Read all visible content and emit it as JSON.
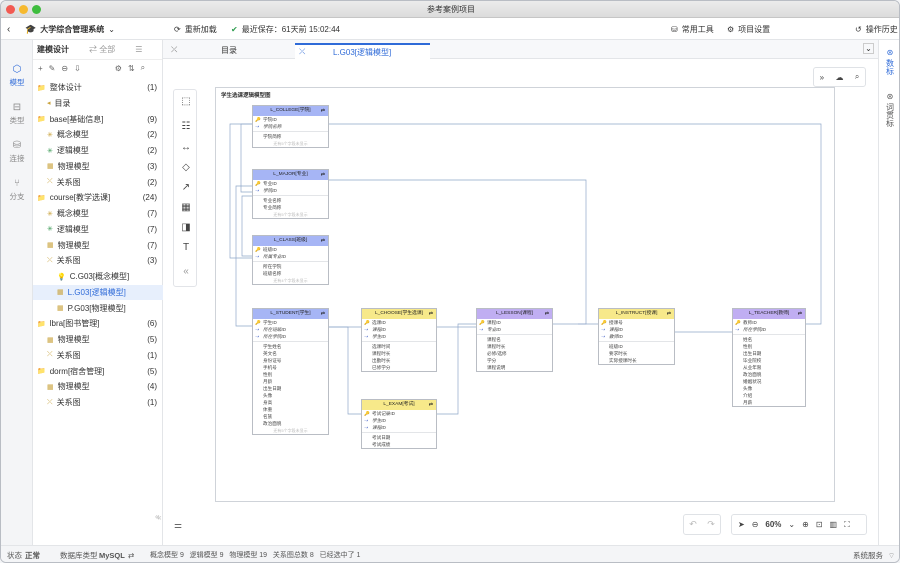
{
  "window": {
    "title": "参考案例项目"
  },
  "topbar": {
    "app_name": "大学综合管理系统",
    "reload": "重新加载",
    "last_save": "最近保存：61天前 15:02:44",
    "common_tools": "常用工具",
    "project_settings": "项目设置",
    "history": "操作历史"
  },
  "rail": {
    "model": "模型",
    "type": "类型",
    "connect": "连接",
    "branch": "分支"
  },
  "sidebar": {
    "tab_design": "建模设计",
    "tab_all": "全部",
    "tree": [
      {
        "label": "整体设计",
        "count": "(1)"
      },
      {
        "label": "目录",
        "count": ""
      },
      {
        "label": "base[基础信息]",
        "count": "(9)"
      },
      {
        "label": "概念模型",
        "count": "(2)"
      },
      {
        "label": "逻辑模型",
        "count": "(2)"
      },
      {
        "label": "物理模型",
        "count": "(3)"
      },
      {
        "label": "关系图",
        "count": "(2)"
      },
      {
        "label": "course[教学选课]",
        "count": "(24)"
      },
      {
        "label": "概念模型",
        "count": "(7)"
      },
      {
        "label": "逻辑模型",
        "count": "(7)"
      },
      {
        "label": "物理模型",
        "count": "(7)"
      },
      {
        "label": "关系图",
        "count": "(3)"
      },
      {
        "label": "C.G03[概念模型]",
        "count": ""
      },
      {
        "label": "L.G03[逻辑模型]",
        "count": ""
      },
      {
        "label": "P.G03[物理模型]",
        "count": ""
      },
      {
        "label": "lbra[图书管理]",
        "count": "(6)"
      },
      {
        "label": "物理模型",
        "count": "(5)"
      },
      {
        "label": "关系图",
        "count": "(1)"
      },
      {
        "label": "dorm[宿舍管理]",
        "count": "(5)"
      },
      {
        "label": "物理模型",
        "count": "(4)"
      },
      {
        "label": "关系图",
        "count": "(1)"
      }
    ]
  },
  "tabs": {
    "catalog": "目录",
    "active": "L.G03[逻辑模型]"
  },
  "right_rail": {
    "data_std": "数标",
    "glossary": "词贯标"
  },
  "diagram": {
    "title": "学生选课逻辑模型图",
    "more": "还有6个字段未显示",
    "entities": [
      {
        "name": "L_COLLEGE[学院]",
        "rows": [
          "学院ID",
          "学院名称",
          "学院简称"
        ],
        "more": "还有5个字段未显示"
      },
      {
        "name": "L_MAJOR[专业]",
        "rows": [
          "专业ID",
          "学院ID",
          "专业名称",
          "专业简称"
        ],
        "more": "还有5个字段未显示"
      },
      {
        "name": "L_CLASS[班级]",
        "rows": [
          "班级ID",
          "所属专业ID",
          "所在学院",
          "班级名称"
        ],
        "more": "还有4个字段未显示"
      },
      {
        "name": "L_STUDENT[学生]",
        "rows": [
          "学生ID",
          "所在班级ID",
          "所在学院ID",
          "学生姓名",
          "英文名",
          "身份证号",
          "手机号",
          "性别",
          "月龄",
          "出生日期",
          "头像",
          "身高",
          "体重",
          "名族",
          "政治面貌"
        ],
        "more": "还有5个字段未显示"
      },
      {
        "name": "L_CHOOSE[学生选课]",
        "rows": [
          "选课ID",
          "课程ID",
          "学生ID",
          "选课时间",
          "课程时长",
          "出勤时长",
          "已修学分"
        ]
      },
      {
        "name": "L_EXAM[考试]",
        "rows": [
          "考试记录ID",
          "学生ID",
          "课程ID",
          "考试日期",
          "考试成绩"
        ]
      },
      {
        "name": "L_LESSON[课程]",
        "rows": [
          "课程ID",
          "专业ID",
          "课程名",
          "课程时长",
          "必修/选修",
          "学分",
          "课程说明"
        ]
      },
      {
        "name": "L_INSTRUCT[授课]",
        "rows": [
          "授课号",
          "课程ID",
          "教师ID",
          "班级ID",
          "要求时长",
          "实际授课时长"
        ]
      },
      {
        "name": "L_TEACHER[教师]",
        "rows": [
          "教师ID",
          "所在学院ID",
          "姓名",
          "性别",
          "出生日期",
          "毕业院校",
          "从业年限",
          "政治面貌",
          "婚姻状况",
          "头像",
          "介绍",
          "月薪"
        ]
      }
    ]
  },
  "zoom": {
    "level": "60%"
  },
  "status": {
    "state_label": "状态",
    "state_value": "正常",
    "dbtype_label": "数据库类型",
    "dbtype_value": "MySQL",
    "counts": "概念模型 9   逻辑模型 9   物理模型 19   关系图总数 8   已经选中了 1",
    "system_service": "系统服务"
  },
  "colors": {
    "accent": "#2f6bd8",
    "entity_blue": "#a6b5f5",
    "entity_yellow": "#f7e98a",
    "entity_purple": "#c0aef2"
  }
}
